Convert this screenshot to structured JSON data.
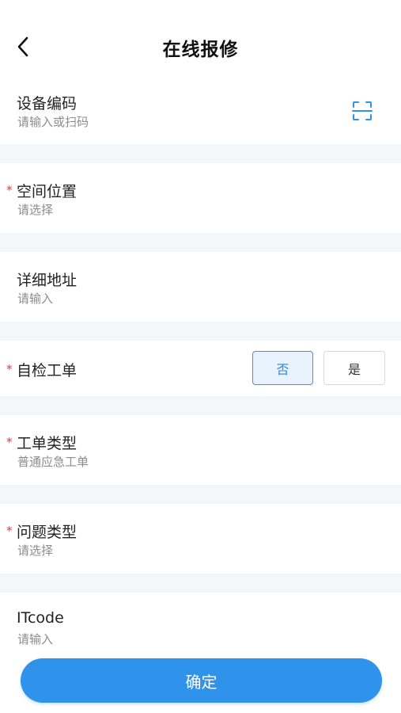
{
  "header": {
    "title": "在线报修",
    "back_icon": "chevron-left-icon"
  },
  "form": {
    "device_code": {
      "label": "设备编码",
      "placeholder": "请输入或扫码",
      "icon": "scan-icon",
      "required": false
    },
    "space_location": {
      "label": "空间位置",
      "placeholder": "请选择",
      "required": true
    },
    "detailed_address": {
      "label": "详细地址",
      "placeholder": "请输入",
      "required": false
    },
    "self_check": {
      "label": "自检工单",
      "required": true,
      "options": [
        "否",
        "是"
      ],
      "selected": "否"
    },
    "work_order_type": {
      "label": "工单类型",
      "value": "普通应急工单",
      "required": true
    },
    "issue_type": {
      "label": "问题类型",
      "placeholder": "请选择",
      "required": true
    },
    "itcode": {
      "label": "ITcode",
      "placeholder": "请输入",
      "required": false
    }
  },
  "required_mark": "*",
  "confirm_label": "确定",
  "colors": {
    "accent": "#2f93ec",
    "required": "#e53935",
    "separator": "#f5f6f7",
    "selected_bg": "#e8f3fd"
  }
}
